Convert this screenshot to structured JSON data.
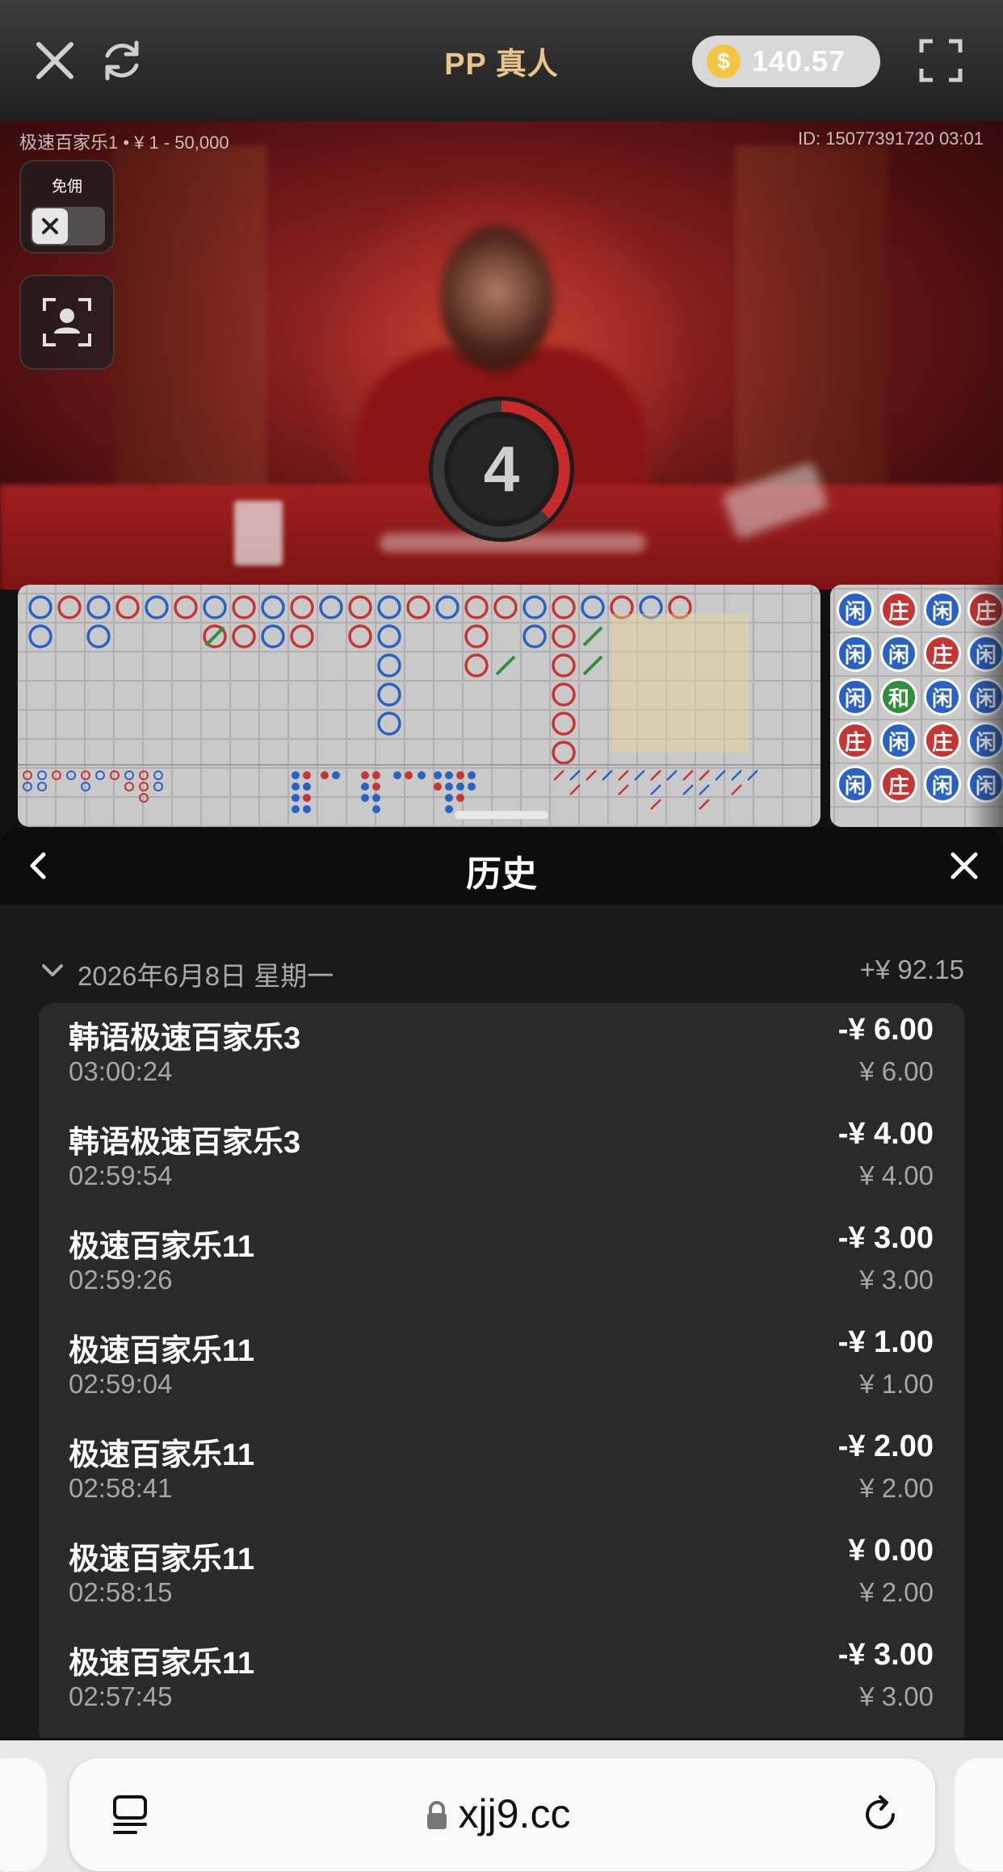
{
  "topbar": {
    "title": "PP 真人",
    "balance": "140.57",
    "coin_symbol": "$"
  },
  "game": {
    "table_info": "极速百家乐1 • ¥ 1 - 50,000",
    "round_id": "ID: 15077391720 03:01",
    "no_commission_label": "免佣",
    "countdown": "4"
  },
  "bead_road": {
    "columns": [
      [
        "闲",
        "闲",
        "闲",
        "庄",
        "闲"
      ],
      [
        "庄",
        "闲",
        "和",
        "闲",
        "庄"
      ],
      [
        "闲",
        "庄",
        "闲",
        "庄",
        "闲"
      ],
      [
        "庄",
        "闲",
        "闲",
        "闲",
        "闲"
      ]
    ]
  },
  "history": {
    "title": "历史",
    "date": "2026年6月8日 星期一",
    "day_total": "+¥ 92.15",
    "rows": [
      {
        "name": "韩语极速百家乐3",
        "time": "03:00:24",
        "result": "-¥ 6.00",
        "bet": "¥ 6.00"
      },
      {
        "name": "韩语极速百家乐3",
        "time": "02:59:54",
        "result": "-¥ 4.00",
        "bet": "¥ 4.00"
      },
      {
        "name": "极速百家乐11",
        "time": "02:59:26",
        "result": "-¥ 3.00",
        "bet": "¥ 3.00"
      },
      {
        "name": "极速百家乐11",
        "time": "02:59:04",
        "result": "-¥ 1.00",
        "bet": "¥ 1.00"
      },
      {
        "name": "极速百家乐11",
        "time": "02:58:41",
        "result": "-¥ 2.00",
        "bet": "¥ 2.00"
      },
      {
        "name": "极速百家乐11",
        "time": "02:58:15",
        "result": "¥ 0.00",
        "bet": "¥ 2.00"
      },
      {
        "name": "极速百家乐11",
        "time": "02:57:45",
        "result": "-¥ 3.00",
        "bet": "¥ 3.00"
      }
    ]
  },
  "browser": {
    "url": "xjj9.cc"
  },
  "colors": {
    "title_gold": "#e9c58c",
    "banker_red": "#c63531",
    "player_blue": "#2a62c4",
    "tie_green": "#2f8f3b",
    "sheet_bg": "#1a1a1a",
    "card_bg": "#2a2a2a"
  },
  "icons": {
    "close": "close-icon",
    "refresh": "refresh-icon",
    "fullscreen": "fullscreen-icon",
    "back": "chevron-left-icon",
    "date_toggle": "chevron-down-icon",
    "lock": "lock-icon",
    "tabs": "tabs-icon",
    "reload": "reload-icon",
    "camera_view": "camera-view-icon"
  }
}
